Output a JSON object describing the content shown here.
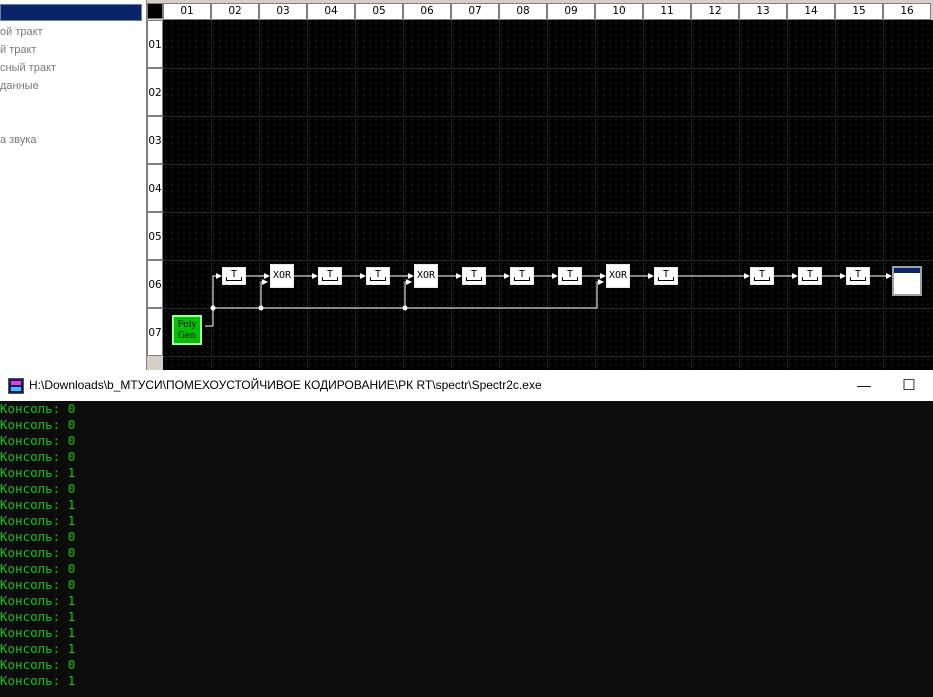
{
  "sidebar": {
    "items": [
      "ой тракт",
      "й тракт",
      "сный тракт",
      "данные",
      "а звука"
    ]
  },
  "grid": {
    "columns": [
      "01",
      "02",
      "03",
      "04",
      "05",
      "06",
      "07",
      "08",
      "09",
      "10",
      "11",
      "12",
      "13",
      "14",
      "15",
      "16"
    ],
    "rows": [
      "01",
      "02",
      "03",
      "04",
      "05",
      "06",
      "07"
    ]
  },
  "blocks": {
    "t_label": "T",
    "xor_label": "XOR",
    "poly_line1": "Poly",
    "poly_line2": "Gen"
  },
  "console": {
    "title": "H:\\Downloads\\b_МТУСИ\\ПОМЕХОУСТОЙЧИВОЕ КОДИРОВАНИЕ\\РК RT\\spectr\\Spectr2c.exe",
    "minimize_label": "—",
    "maximize_label": "☐",
    "lines": [
      "Консоль: 0",
      "Консоль: 0",
      "Консоль: 0",
      "Консоль: 0",
      "Консоль: 1",
      "Консоль: 0",
      "Консоль: 1",
      "Консоль: 1",
      "Консоль: 0",
      "Консоль: 0",
      "Консоль: 0",
      "Консоль: 0",
      "Консоль: 1",
      "Консоль: 1",
      "Консоль: 1",
      "Консоль: 1",
      "Консоль: 0",
      "Консоль: 1"
    ]
  },
  "colors": {
    "console_text": "#13c613",
    "canvas_bg": "#000000",
    "poly_gen": "#00c000",
    "titlebar_active": "#0a246a"
  }
}
